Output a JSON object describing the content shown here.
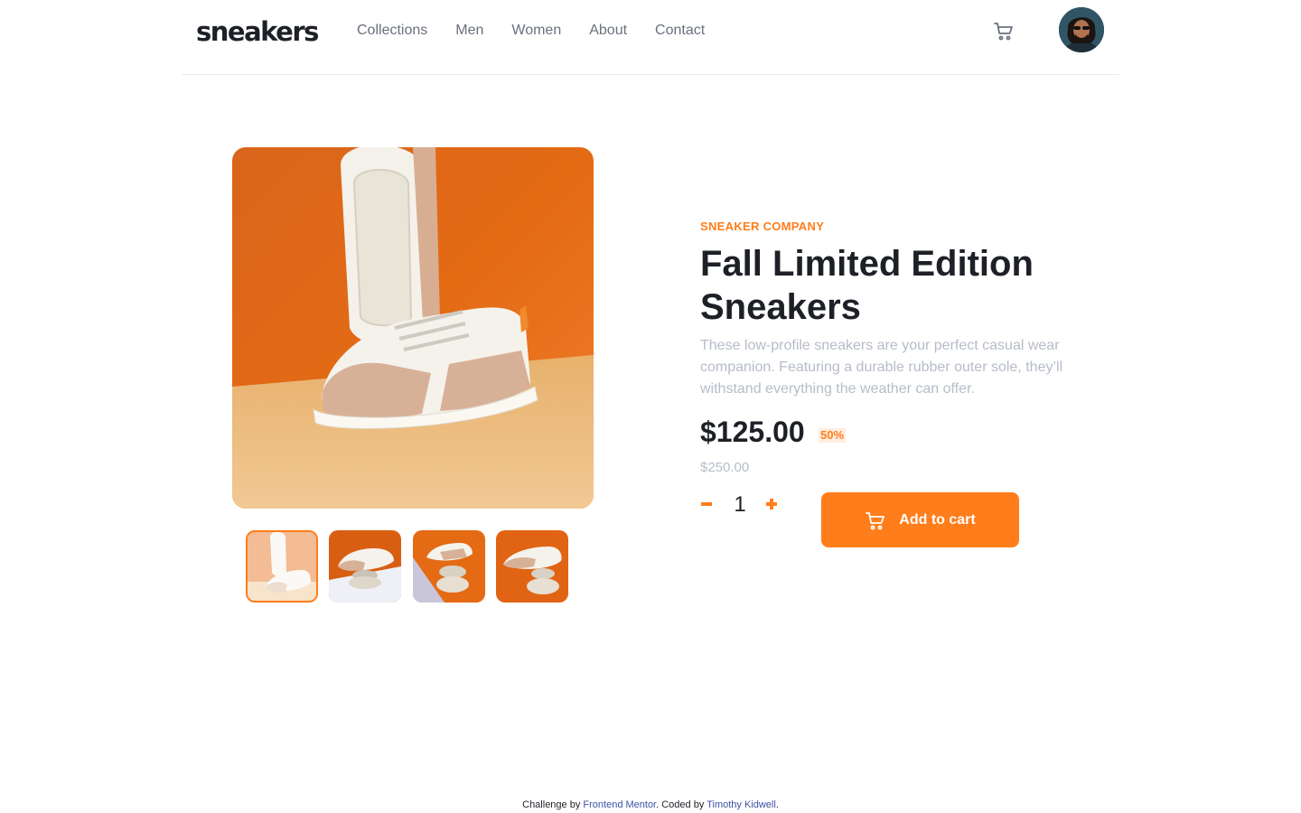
{
  "header": {
    "logo": "sneakers",
    "nav": [
      "Collections",
      "Men",
      "Women",
      "About",
      "Contact"
    ],
    "cart_icon": "cart-icon",
    "avatar_icon": "avatar-image"
  },
  "gallery": {
    "main_image": "product-image-1",
    "thumbnails": [
      "product-thumbnail-1",
      "product-thumbnail-2",
      "product-thumbnail-3",
      "product-thumbnail-4"
    ],
    "active_index": 0
  },
  "product": {
    "company": "SNEAKER COMPANY",
    "title": "Fall Limited Edition Sneakers",
    "description": "These low-profile sneakers are your perfect casual wear companion. Featuring a durable rubber outer sole, they’ll withstand everything the weather can offer.",
    "price": "$125.00",
    "discount": "50%",
    "original_price": "$250.00",
    "quantity": "1",
    "add_to_cart": "Add to cart"
  },
  "footer": {
    "challenge_prefix": "Challenge by ",
    "challenge_link": "Frontend Mentor",
    "coded_prefix": ". Coded by ",
    "coded_link": "Timothy Kidwell",
    "suffix": "."
  },
  "colors": {
    "accent": "#ff7d1a",
    "accent_pale": "#ffede0",
    "dark": "#1d2026",
    "grey_text": "#69707d",
    "light_grey_text": "#b6bcc8",
    "link": "#3e52a3"
  }
}
